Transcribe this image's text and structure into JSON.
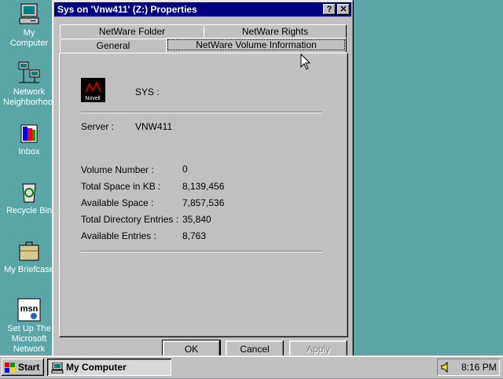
{
  "desktop": {
    "icons": [
      {
        "label": "My Computer",
        "icon": "computer-icon"
      },
      {
        "label": "Network Neighborhood",
        "icon": "network-icon"
      },
      {
        "label": "Inbox",
        "icon": "inbox-icon"
      },
      {
        "label": "Recycle Bin",
        "icon": "recycle-bin-icon"
      },
      {
        "label": "My Briefcase",
        "icon": "briefcase-icon"
      },
      {
        "label": "Set Up The Microsoft Network",
        "icon": "msn-icon"
      }
    ]
  },
  "window": {
    "title": "Sys on 'Vnw411' (Z:) Properties",
    "help_label": "?",
    "close_label": "✕",
    "tabs_back": [
      {
        "label": "NetWare Folder"
      },
      {
        "label": "NetWare Rights"
      }
    ],
    "tabs_front": [
      {
        "label": "General"
      },
      {
        "label": "NetWare Volume Information"
      }
    ],
    "active_tab": "NetWare Volume Information",
    "volume": {
      "logo_text": "Novell",
      "name": "SYS :",
      "server_label": "Server :",
      "server_value": "VNW411",
      "rows": [
        {
          "label": "Volume Number :",
          "value": "0"
        },
        {
          "label": "Total Space in KB :",
          "value": "8,139,456"
        },
        {
          "label": "Available Space :",
          "value": "7,857,536"
        },
        {
          "label": "Total Directory Entries :",
          "value": "35,840"
        },
        {
          "label": "Available Entries :",
          "value": "8,763"
        }
      ]
    },
    "buttons": {
      "ok": "OK",
      "cancel": "Cancel",
      "apply": "Apply"
    }
  },
  "taskbar": {
    "start_label": "Start",
    "task_label": "My Computer",
    "clock": "8:16 PM"
  },
  "colors": {
    "desktop": "#5aa5a6",
    "titlebar": "#000080",
    "face": "#c0c0c0"
  }
}
